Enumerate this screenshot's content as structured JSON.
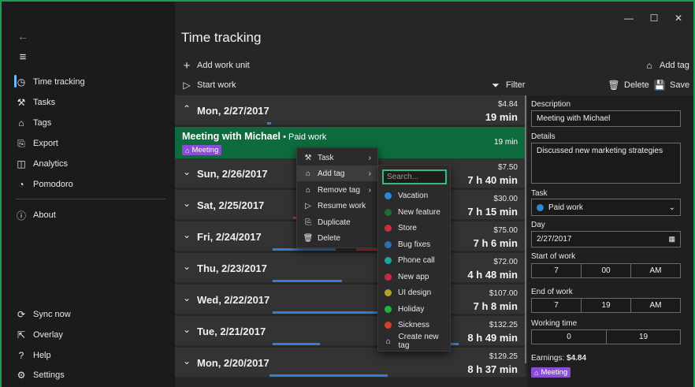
{
  "window": {
    "minimize": "—",
    "maximize": "☐",
    "close": "✕"
  },
  "sidebar": {
    "back": "←",
    "menu": "≡",
    "items": [
      {
        "label": "Time tracking",
        "icon": "time-tracking-icon",
        "glyph": "◷"
      },
      {
        "label": "Tasks",
        "icon": "wrench-icon",
        "glyph": "⚒"
      },
      {
        "label": "Tags",
        "icon": "tag-icon",
        "glyph": "⌂"
      },
      {
        "label": "Export",
        "icon": "export-icon",
        "glyph": "⎘"
      },
      {
        "label": "Analytics",
        "icon": "analytics-icon",
        "glyph": "◫"
      },
      {
        "label": "Pomodoro",
        "icon": "pomodoro-icon",
        "glyph": "◔"
      },
      {
        "label": "About",
        "icon": "info-icon",
        "glyph": "ⓘ"
      }
    ],
    "bottom": [
      {
        "label": "Sync now",
        "icon": "sync-icon",
        "glyph": "⟳"
      },
      {
        "label": "Overlay",
        "icon": "overlay-icon",
        "glyph": "⇱"
      },
      {
        "label": "Help",
        "icon": "help-icon",
        "glyph": "?"
      },
      {
        "label": "Settings",
        "icon": "gear-icon",
        "glyph": "⚙"
      }
    ]
  },
  "header": {
    "title": "Time tracking",
    "add_work_unit": "Add work unit",
    "add_tag": "Add tag",
    "start_work": "Start work",
    "filter": "Filter",
    "delete": "Delete",
    "save": "Save"
  },
  "days": [
    {
      "date": "Mon, 2/27/2017",
      "money": "$4.84",
      "duration": "19 min"
    },
    {
      "date": "Sun, 2/26/2017",
      "money": "$7.50",
      "duration": "7 h 40 min"
    },
    {
      "date": "Sat, 2/25/2017",
      "money": "$30.00",
      "duration": "7 h 15 min"
    },
    {
      "date": "Fri, 2/24/2017",
      "money": "$75.00",
      "duration": "7 h 6 min"
    },
    {
      "date": "Thu, 2/23/2017",
      "money": "$72.00",
      "duration": "4 h 48 min"
    },
    {
      "date": "Wed, 2/22/2017",
      "money": "$107.00",
      "duration": "7 h 8 min"
    },
    {
      "date": "Tue, 2/21/2017",
      "money": "$132.25",
      "duration": "8 h 49 min"
    },
    {
      "date": "Mon, 2/20/2017",
      "money": "$129.25",
      "duration": "8 h 37 min"
    }
  ],
  "entry": {
    "name": "Meeting with Michael",
    "task": " • Paid work",
    "duration": "19 min",
    "tag": "Meeting"
  },
  "context_menu": {
    "items": [
      {
        "label": "Task",
        "icon": "wrench-icon",
        "glyph": "⚒",
        "submenu": true
      },
      {
        "label": "Add tag",
        "icon": "add-tag-icon",
        "glyph": "⌂",
        "submenu": true
      },
      {
        "label": "Remove tag",
        "icon": "remove-tag-icon",
        "glyph": "⌂",
        "submenu": true
      },
      {
        "label": "Resume work",
        "icon": "play-icon",
        "glyph": "▷",
        "submenu": false
      },
      {
        "label": "Duplicate",
        "icon": "duplicate-icon",
        "glyph": "⎘",
        "submenu": false
      },
      {
        "label": "Delete",
        "icon": "trash-icon",
        "glyph": "🗑",
        "submenu": false
      }
    ]
  },
  "tag_submenu": {
    "search_placeholder": "Search...",
    "tags": [
      {
        "label": "Vacation",
        "color": "#2f86d6"
      },
      {
        "label": "New feature",
        "color": "#1e6b35"
      },
      {
        "label": "Store",
        "color": "#c9303a"
      },
      {
        "label": "Bug fixes",
        "color": "#2f6eb0"
      },
      {
        "label": "Phone call",
        "color": "#1fa39a"
      },
      {
        "label": "New app",
        "color": "#c92848"
      },
      {
        "label": "UI design",
        "color": "#b5a22a"
      },
      {
        "label": "Holiday",
        "color": "#25b23c"
      },
      {
        "label": "Sickness",
        "color": "#d0402a"
      }
    ],
    "create": "Create new tag"
  },
  "details": {
    "description_label": "Description",
    "description": "Meeting with Michael",
    "details_label": "Details",
    "details": "Discussed new marketing strategies",
    "task_label": "Task",
    "task": "Paid work",
    "task_color": "#2f86d6",
    "day_label": "Day",
    "day": "2/27/2017",
    "start_label": "Start of work",
    "start": [
      "7",
      "00",
      "AM"
    ],
    "end_label": "End of work",
    "end": [
      "7",
      "19",
      "AM"
    ],
    "working_label": "Working time",
    "working": [
      "0",
      "19"
    ],
    "earnings_label": "Earnings:",
    "earnings": "$4.84",
    "tag": "Meeting"
  },
  "colors": {
    "accent_green": "#0e6b3e",
    "tag_purple": "#8a4dd6",
    "bar_blue": "#2f7fd8"
  }
}
